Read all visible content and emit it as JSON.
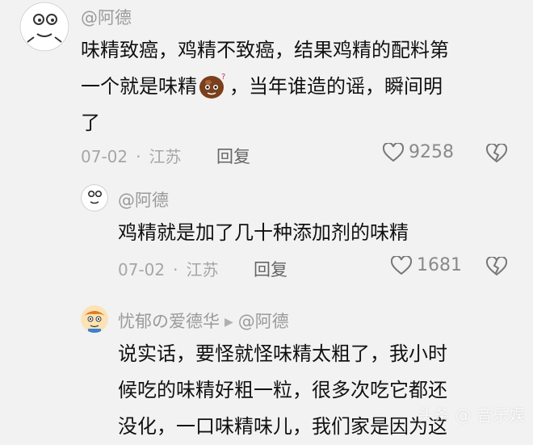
{
  "comments": [
    {
      "username": "@阿德",
      "lines": [
        "味精致癌，鸡精不致癌，结果鸡精的配料第",
        "一个就是味精",
        "，当年谁造的谣，瞬间明",
        "了"
      ],
      "inline_emoji": "thinking-chestnut-emoji",
      "date": "07-02",
      "location": "江苏",
      "reply_label": "回复",
      "likes": "9258"
    },
    {
      "username": "@阿德",
      "lines": [
        "鸡精就是加了几十种添加剂的味精"
      ],
      "date": "07-02",
      "location": "江苏",
      "reply_label": "回复",
      "likes": "1681"
    },
    {
      "username": "忧郁の爱德华",
      "reply_to": "@阿德",
      "lines": [
        "说实话，要怪就怪味精太粗了，我小时",
        "候吃的味精好粗一粒，很多次吃它都还",
        "没化，一口味精味儿，我们家是因为这"
      ]
    }
  ],
  "separator_dot": "·",
  "reply_arrow": "▶",
  "watermark": "头条 @ 音乐娱",
  "colors": {
    "background": "#f2f2f2",
    "meta_gray": "#a6a6a6",
    "text": "#111111"
  }
}
